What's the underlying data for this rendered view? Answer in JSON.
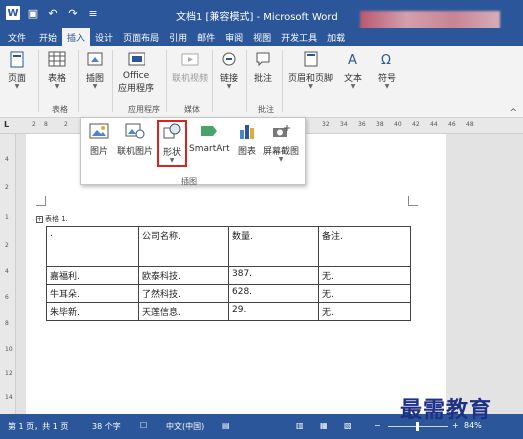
{
  "window": {
    "title": "文档1 [兼容模式] - Microsoft Word",
    "app_icon": "W",
    "undo_glyph": "↶",
    "redo_glyph": "↷",
    "save_glyph": "▣",
    "customize_glyph": "≡",
    "brand_color": "#2b579a"
  },
  "tabs": [
    "文件",
    "开始",
    "插入",
    "设计",
    "页面布局",
    "引用",
    "邮件",
    "审阅",
    "视图",
    "开发工具",
    "加载"
  ],
  "active_tab": "插入",
  "ribbon": {
    "buttons": {
      "page": "页面",
      "table": "表格",
      "illustrations": "插图",
      "office_apps": "Office",
      "office_apps_sub": "应用程序",
      "online_video": "联机视频",
      "link": "链接",
      "comment": "批注",
      "header_footer": "页眉和页脚",
      "text": "文本",
      "symbol": "符号"
    },
    "groups": {
      "table": "表格",
      "apps": "应用程序",
      "media": "媒体",
      "comments": "批注"
    },
    "collapse": "^"
  },
  "illustrations_dropdown": {
    "items": [
      "图片",
      "联机图片",
      "形状",
      "SmartArt",
      "图表",
      "屏幕截图"
    ],
    "group_label": "插图",
    "highlighted": "形状"
  },
  "ruler": {
    "corner": "L",
    "ticks": [
      "2",
      "8",
      "2",
      "32",
      "34",
      "36",
      "38",
      "40",
      "42",
      "44",
      "46",
      "48"
    ]
  },
  "vruler": {
    "ticks": [
      "4",
      "2",
      "1",
      "2",
      "4",
      "6",
      "8",
      "10",
      "12",
      "14"
    ]
  },
  "document": {
    "caption": "表格 1.",
    "table": [
      [
        ".",
        "公司名称.",
        "数量.",
        "备注."
      ],
      [
        "嘉福利.",
        "欧泰科技.",
        "387.",
        "无."
      ],
      [
        "牛耳朵.",
        "了然科技.",
        "628.",
        "无."
      ],
      [
        "朱毕新.",
        "天莲信息.",
        "29.",
        "无."
      ]
    ]
  },
  "status_bar": {
    "page": "第 1 页，共 1 页",
    "words": "38 个字",
    "lang": "中文(中国)",
    "zoom": "84%"
  },
  "watermark": "最需教育"
}
